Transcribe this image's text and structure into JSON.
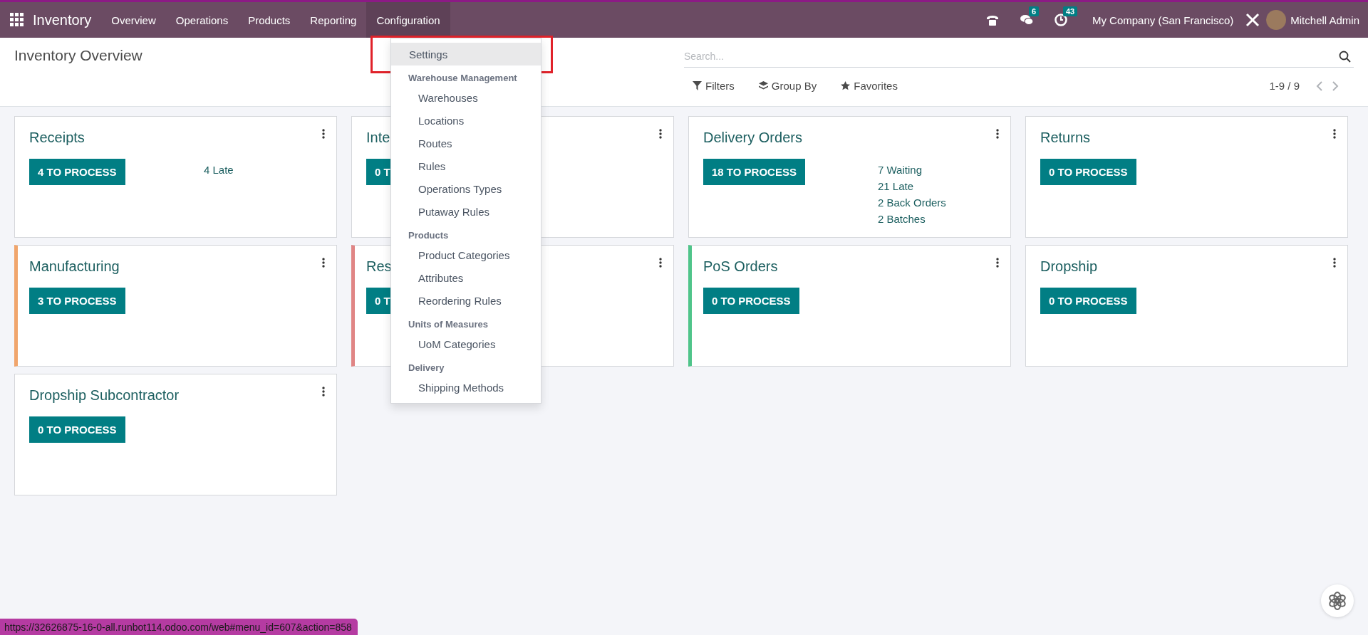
{
  "navbar": {
    "app_name": "Inventory",
    "menu": [
      {
        "label": "Overview",
        "open": false
      },
      {
        "label": "Operations",
        "open": false
      },
      {
        "label": "Products",
        "open": false
      },
      {
        "label": "Reporting",
        "open": false
      },
      {
        "label": "Configuration",
        "open": true
      }
    ],
    "systray": [
      {
        "kind": "phone"
      },
      {
        "kind": "chat",
        "badge": "6"
      },
      {
        "kind": "activity",
        "badge": "43"
      }
    ],
    "company": "My Company (San Francisco)",
    "user": "Mitchell Admin"
  },
  "control_panel": {
    "title": "Inventory Overview",
    "search": {
      "placeholder": "Search..."
    },
    "filters": [
      {
        "kind": "filter",
        "label": "Filters"
      },
      {
        "kind": "group",
        "label": "Group By"
      },
      {
        "kind": "star",
        "label": "Favorites"
      }
    ],
    "pager": "1-9 / 9"
  },
  "dropdown": [
    {
      "kind": "item",
      "label": "Settings",
      "selected": true
    },
    {
      "kind": "header",
      "label": "Warehouse Management"
    },
    {
      "kind": "item",
      "label": "Warehouses",
      "selected": false
    },
    {
      "kind": "item",
      "label": "Locations",
      "selected": false
    },
    {
      "kind": "item",
      "label": "Routes",
      "selected": false
    },
    {
      "kind": "item",
      "label": "Rules",
      "selected": false
    },
    {
      "kind": "item",
      "label": "Operations Types",
      "selected": false
    },
    {
      "kind": "item",
      "label": "Putaway Rules",
      "selected": false
    },
    {
      "kind": "header",
      "label": "Products"
    },
    {
      "kind": "item",
      "label": "Product Categories",
      "selected": false
    },
    {
      "kind": "item",
      "label": "Attributes",
      "selected": false
    },
    {
      "kind": "item",
      "label": "Reordering Rules",
      "selected": false
    },
    {
      "kind": "header",
      "label": "Units of Measures"
    },
    {
      "kind": "item",
      "label": "UoM Categories",
      "selected": false
    },
    {
      "kind": "header",
      "label": "Delivery"
    },
    {
      "kind": "item",
      "label": "Shipping Methods",
      "selected": false
    }
  ],
  "cards": [
    {
      "title": "Receipts",
      "button": "4 TO PROCESS",
      "stats": [
        "4 Late"
      ]
    },
    {
      "title": "Inte",
      "button": "0 T"
    },
    {
      "title": "Delivery Orders",
      "button": "18 TO PROCESS",
      "stats": [
        "7 Waiting",
        "21 Late",
        "2 Back Orders",
        "2 Batches"
      ]
    },
    {
      "title": "Returns",
      "button": "0 TO PROCESS"
    },
    {
      "title": "Manufacturing",
      "button": "3 TO PROCESS",
      "color": "#f0a56c"
    },
    {
      "title": "Res",
      "button": "0 T",
      "color": "#e08585"
    },
    {
      "title": "PoS Orders",
      "button": "0 TO PROCESS",
      "color": "#4fc48a"
    },
    {
      "title": "Dropship",
      "button": "0 TO PROCESS"
    },
    {
      "title": "Dropship Subcontractor",
      "button": "0 TO PROCESS"
    }
  ],
  "status_url": "https://32626875-16-0-all.runbot114.odoo.com/web#menu_id=607&action=858"
}
